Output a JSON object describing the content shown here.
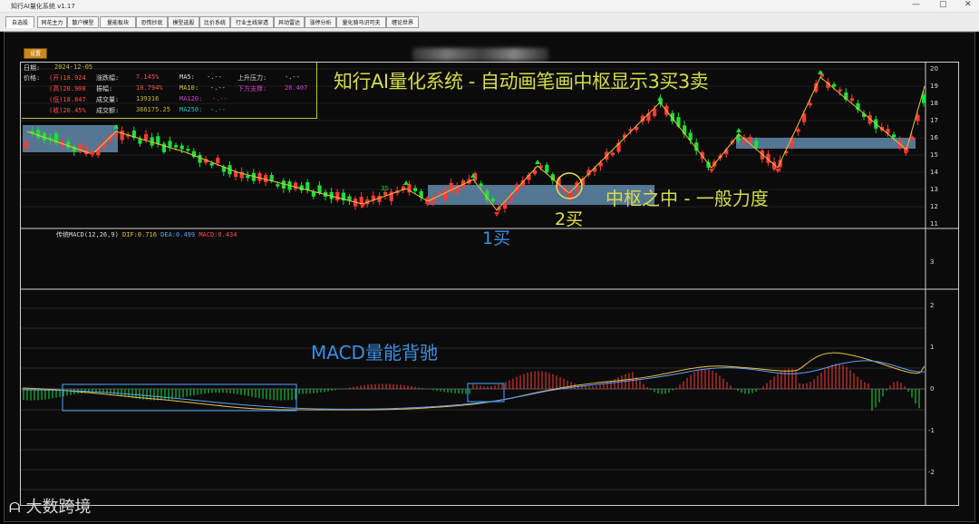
{
  "window": {
    "title": "知行AI量化系统 v1.17",
    "controls": [
      "—",
      "▢",
      "✕"
    ]
  },
  "tabs": [
    "自选股",
    "同花主力",
    "散户模型",
    "量能板块",
    "恐慌抄底",
    "模型选股",
    "比价系统",
    "行业主线穿透",
    "异动雷达",
    "涨停分析",
    "量化骑马识可夫",
    "缠论世界"
  ],
  "toolbar": {
    "settings_label": "设置"
  },
  "info": {
    "date_label": "日期:",
    "date_value": "2024-12-05",
    "price_label": "价格:",
    "open": "(开)18.924",
    "high": "(高)20.908",
    "low": "(低)18.847",
    "close": "(收)20.45%",
    "chg_label": "涨跌幅:",
    "chg_value": "7.145%",
    "amp_label": "振幅:",
    "amp_value": "10.794%",
    "vol_label": "成交量:",
    "vol_value": "139316",
    "amt_label": "成交额:",
    "amt_value": "366175.25",
    "ma5_label": "MA5:",
    "ma5_value": "-.--",
    "ma10_label": "MA10:",
    "ma10_value": "-.--",
    "ma120_label": "MA120:",
    "ma120_value": "-.--",
    "ma250_label": "MA250:",
    "ma250_value": "-.--",
    "resist_label": "上升压力:",
    "resist_value": "-.--",
    "support_label": "下方支撑:",
    "support_value": "26.407"
  },
  "annotations": {
    "title": "知行AI量化系统 - 自动画笔画中枢显示3买3卖",
    "zhongshu": "中枢之中 - 一般力度",
    "buy1": "1买",
    "buy2": "2买",
    "third_buy": "3S",
    "macd_divergence": "MACD量能背驰"
  },
  "macd": {
    "label": "传统MACD(12,26,9)",
    "dif": "DIF:0.716",
    "dea": "DEA:0.499",
    "macd": "MACD:0.434"
  },
  "price_axis": [
    "20",
    "19",
    "18",
    "17",
    "16",
    "15",
    "14",
    "13",
    "12",
    "11"
  ],
  "mid_axis": [
    "3"
  ],
  "macd_axis": [
    "2",
    "1",
    "0",
    "-1",
    "-2"
  ],
  "colors": {
    "up": "#ff3b3b",
    "down": "#18e13a",
    "zhongshu": "#6fa0c8",
    "bi_line": "#e6c23a",
    "accent_title": "#d4dc4a",
    "annot_blue": "#3b8fe0"
  },
  "watermark": "大数跨境"
}
